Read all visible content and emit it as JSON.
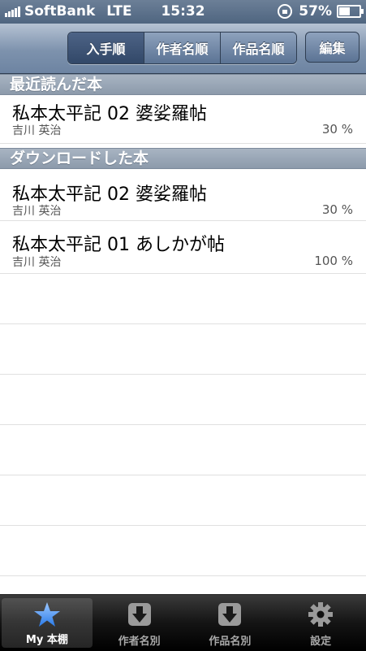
{
  "status_bar": {
    "carrier": "SoftBank",
    "network": "LTE",
    "time": "15:32",
    "battery": "57%"
  },
  "toolbar": {
    "segments": [
      "入手順",
      "作者名順",
      "作品名順"
    ],
    "selected_segment": "入手順",
    "edit_label": "編集"
  },
  "sections": [
    {
      "header": "最近読んだ本",
      "books": [
        {
          "title": "私本太平記 02 婆娑羅帖",
          "author": "吉川 英治",
          "progress": "30 %"
        }
      ]
    },
    {
      "header": "ダウンロードした本",
      "books": [
        {
          "title": "私本太平記 02 婆娑羅帖",
          "author": "吉川 英治",
          "progress": "30 %"
        },
        {
          "title": "私本太平記 01 あしかが帖",
          "author": "吉川 英治",
          "progress": "100 %"
        }
      ]
    }
  ],
  "tab_bar": {
    "tabs": [
      {
        "label": "My 本棚",
        "icon": "star-icon",
        "selected": true
      },
      {
        "label": "作者名別",
        "icon": "download-icon",
        "selected": false
      },
      {
        "label": "作品名別",
        "icon": "download-icon",
        "selected": false
      },
      {
        "label": "設定",
        "icon": "gear-icon",
        "selected": false
      }
    ]
  },
  "colors": {
    "accent_blue": "#3f8ff5",
    "navbar": "#7d92ad",
    "section_header": "#9aa7b7"
  }
}
